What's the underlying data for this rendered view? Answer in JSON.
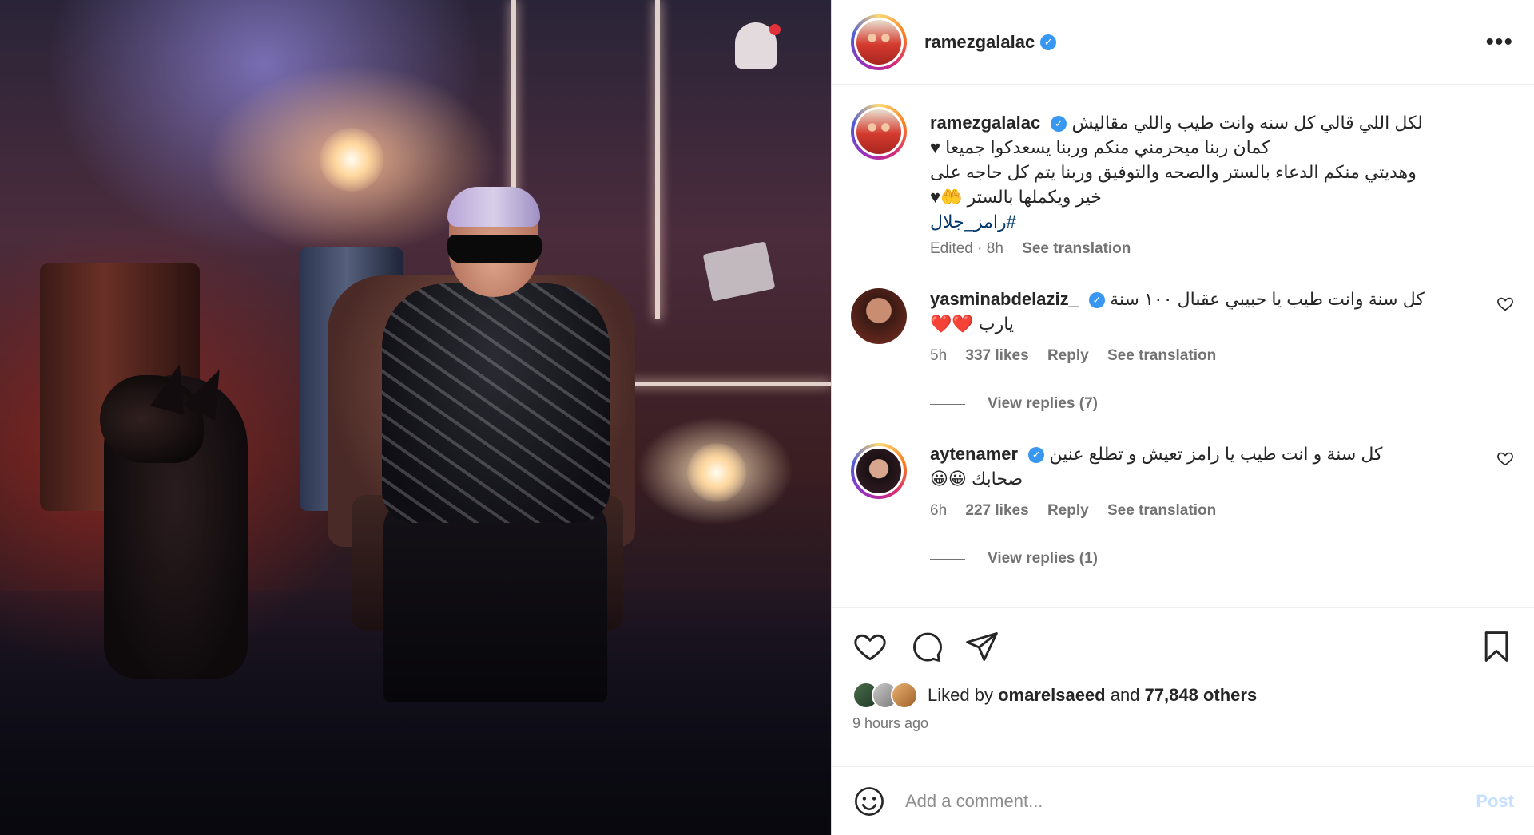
{
  "post": {
    "author": {
      "username": "ramezgalalac",
      "verified": true
    },
    "more_icon": "more-horizontal-icon",
    "caption": {
      "username": "ramezgalalac",
      "line1": "لكل اللي قالي كل سنه وانت طيب واللي مقاليش",
      "line2": "كمان ربنا ميحرمني منكم وربنا يسعدكوا جميعا ♥",
      "line3": "وهديتي منكم الدعاء بالستر والصحه والتوفيق وربنا يتم كل حاجه على",
      "line4": "خير ويكملها بالستر 🤲♥",
      "hashtag": "#رامز_جلال",
      "edited": "Edited · 8h",
      "see_translation": "See translation"
    },
    "comments": [
      {
        "username": "yasminabdelaziz_",
        "verified": true,
        "text_line1": "كل سنة وانت طيب يا حبيبي عقبال ١٠٠ سنة",
        "text_line2": "يارب ❤️❤️",
        "time": "5h",
        "likes": "337 likes",
        "reply": "Reply",
        "see_translation": "See translation",
        "view_replies": "View replies (7)"
      },
      {
        "username": "aytenamer",
        "verified": true,
        "text_line1": "كل سنة و انت طيب يا رامز تعيش و تطلع عنين",
        "text_line2": "صحابك 😀😀",
        "time": "6h",
        "likes": "227 likes",
        "reply": "Reply",
        "see_translation": "See translation",
        "view_replies": "View replies (1)"
      }
    ],
    "actions": {
      "like_icon": "heart-icon",
      "comment_icon": "comment-icon",
      "share_icon": "send-icon",
      "save_icon": "bookmark-icon"
    },
    "likes": {
      "prefix": "Liked by",
      "user": "omarelsaeed",
      "and": "and",
      "others": "77,848 others"
    },
    "time_ago": "9 hours ago",
    "add_comment": {
      "placeholder": "Add a comment...",
      "post_label": "Post",
      "emoji_icon": "smiley-icon"
    }
  },
  "colors": {
    "link": "#00376b",
    "verified": "#3897f0",
    "muted": "#737373",
    "post_disabled": "#c7e0fd"
  }
}
